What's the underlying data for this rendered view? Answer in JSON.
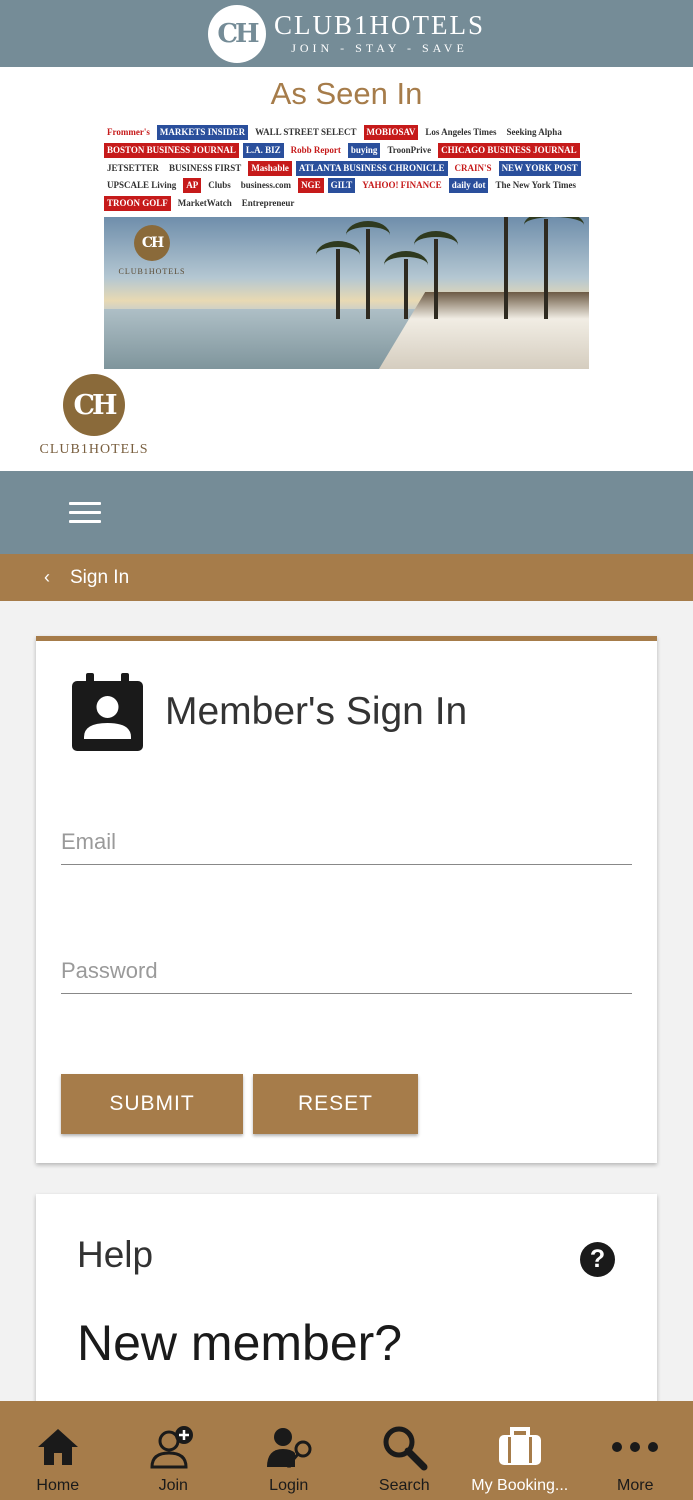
{
  "header": {
    "brand_mark": "CH",
    "brand_name": "CLUB1HOTELS",
    "brand_tagline": "JOIN - STAY - SAVE"
  },
  "as_seen_in": {
    "title": "As Seen In",
    "press_logos": [
      "Frommer's",
      "MARKETS INSIDER",
      "WALL STREET SELECT",
      "MOBIOSAV",
      "Los Angeles Times",
      "Seeking Alpha",
      "BOSTON BUSINESS JOURNAL",
      "L.A. BIZ",
      "Robb Report",
      "buying",
      "TroonPrive",
      "CHICAGO BUSINESS JOURNAL",
      "JETSETTER",
      "BUSINESS FIRST",
      "Mashable",
      "ATLANTA BUSINESS CHRONICLE",
      "CRAIN'S",
      "NEW YORK POST",
      "UPSCALE Living",
      "AP",
      "Clubs",
      "business.com",
      "NGE",
      "GILT",
      "YAHOO! FINANCE",
      "daily dot",
      "The New York Times",
      "TROON GOLF",
      "MarketWatch",
      "Entrepreneur"
    ],
    "banner_logo_mark": "CH",
    "banner_logo_label": "CLUB1HOTELS"
  },
  "site_logo": {
    "mark": "CH",
    "label": "CLUB1HOTELS"
  },
  "breadcrumb": {
    "back_icon": "‹",
    "title": "Sign In"
  },
  "signin": {
    "title": "Member's Sign In",
    "icon": "contact-card-icon",
    "email_placeholder": "Email",
    "email_value": "",
    "password_placeholder": "Password",
    "password_value": "",
    "submit_label": "SUBMIT",
    "reset_label": "RESET"
  },
  "help": {
    "title": "Help",
    "help_icon": "?",
    "new_member": "New member?"
  },
  "bottom_nav": [
    {
      "label": "Home",
      "icon": "home-icon"
    },
    {
      "label": "Join",
      "icon": "add-user-icon"
    },
    {
      "label": "Login",
      "icon": "key-user-icon"
    },
    {
      "label": "Search",
      "icon": "search-icon"
    },
    {
      "label": "My Booking...",
      "icon": "briefcase-icon"
    },
    {
      "label": "More",
      "icon": "more-dots-icon"
    }
  ],
  "colors": {
    "slate": "#758c97",
    "gold": "#a67c4a"
  }
}
